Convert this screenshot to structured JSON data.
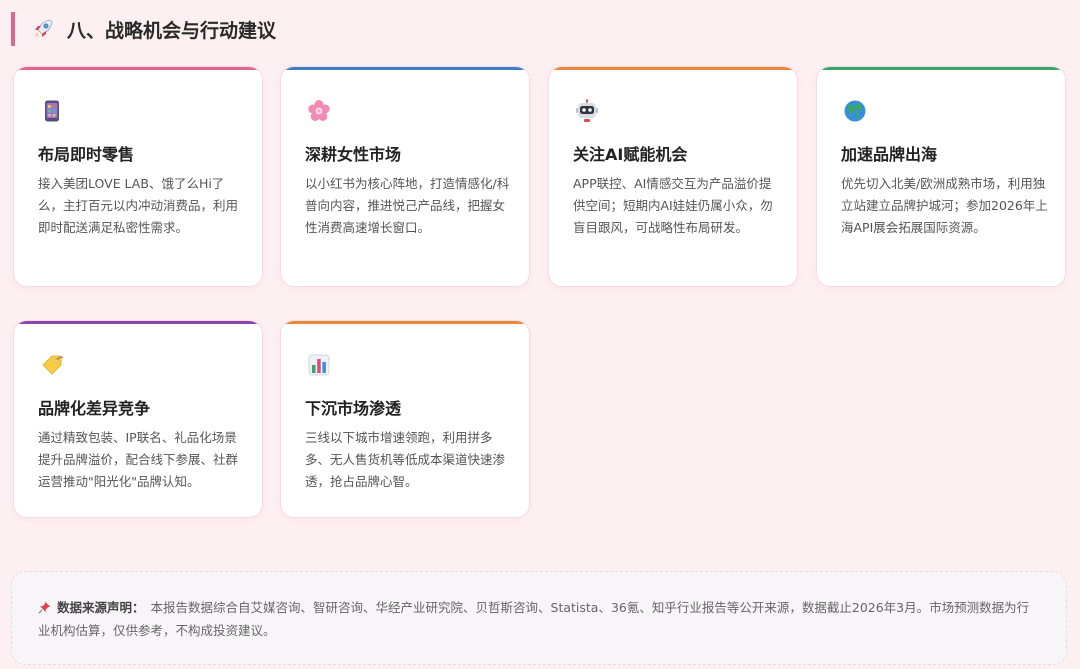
{
  "section": {
    "title": "八、战略机会与行动建议",
    "icon": "rocket-icon"
  },
  "cards": [
    {
      "title": "布局即时零售",
      "icon": "mobile-phone-icon",
      "accent": "#e0668d",
      "desc": "接入美团LOVE LAB、饿了么Hi了么，主打百元以内冲动消费品，利用即时配送满足私密性需求。"
    },
    {
      "title": "深耕女性市场",
      "icon": "flower-icon",
      "accent": "#3d7fc4",
      "desc": "以小红书为核心阵地，打造情感化/科普向内容，推进悦己产品线，把握女性消费高速增长窗口。"
    },
    {
      "title": "关注AI赋能机会",
      "icon": "robot-icon",
      "accent": "#e68a3a",
      "desc": "APP联控、AI情感交互为产品溢价提供空间；短期内AI娃娃仍属小众，勿盲目跟风，可战略性布局研发。"
    },
    {
      "title": "加速品牌出海",
      "icon": "globe-icon",
      "accent": "#3aa864",
      "desc": "优先切入北美/欧洲成熟市场，利用独立站建立品牌护城河；参加2026年上海API展会拓展国际资源。"
    },
    {
      "title": "品牌化差异竞争",
      "icon": "tag-icon",
      "accent": "#8e44ad",
      "desc": "通过精致包装、IP联名、礼品化场景提升品牌溢价，配合线下参展、社群运营推动\"阳光化\"品牌认知。"
    },
    {
      "title": "下沉市场渗透",
      "icon": "bar-chart-icon",
      "accent": "#e68a3a",
      "desc": "三线以下城市增速领跑，利用拼多多、无人售货机等低成本渠道快速渗透，抢占品牌心智。"
    }
  ],
  "footer": {
    "icon": "pushpin-icon",
    "label": "数据来源声明：",
    "text": "本报告数据综合自艾媒咨询、智研咨询、华经产业研究院、贝哲斯咨询、Statista、36氪、知乎行业报告等公开来源，数据截止2026年3月。市场预测数据为行业机构估算，仅供参考，不构成投资建议。"
  }
}
